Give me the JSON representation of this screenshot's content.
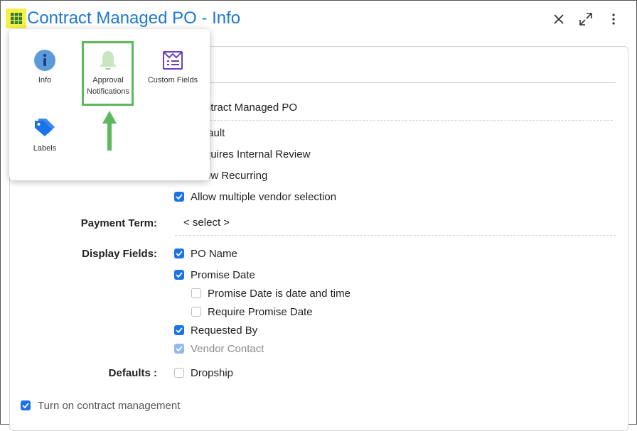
{
  "header": {
    "title": "Contract Managed PO - Info",
    "apps_icon": "grid-apps-icon",
    "close_icon": "close-icon",
    "expand_icon": "expand-icon",
    "more_icon": "more-vertical-icon"
  },
  "app_menu": {
    "items": [
      {
        "label": "Info",
        "icon": "info-icon"
      },
      {
        "label": "Approval Notifications",
        "icon": "bell-icon"
      },
      {
        "label": "Custom Fields",
        "icon": "custom-fields-icon"
      },
      {
        "label": "Labels",
        "icon": "tag-icon"
      }
    ]
  },
  "form": {
    "name_value": "ntract Managed PO",
    "flags": [
      {
        "label": "fault",
        "checked": null
      },
      {
        "label": "quires Internal Review",
        "checked": null
      },
      {
        "label": "ow Recurring",
        "checked": null
      },
      {
        "label": "Allow multiple vendor selection",
        "checked": true
      }
    ],
    "payment_term_label": "Payment Term:",
    "payment_term_value": "< select >",
    "display_fields_label": "Display Fields:",
    "display_fields": [
      {
        "label": "PO Name",
        "checked": true
      },
      {
        "label": "Promise Date",
        "checked": true
      },
      {
        "label": "Promise Date is date and time",
        "checked": false
      },
      {
        "label": "Require Promise Date",
        "checked": false
      },
      {
        "label": "Requested By",
        "checked": true
      },
      {
        "label": "Vendor Contact",
        "checked": true,
        "disabled": true
      }
    ],
    "defaults_label": "Defaults :",
    "defaults": [
      {
        "label": "Dropship",
        "checked": false
      }
    ],
    "contract_management_label": "Turn on contract management",
    "contract_management_checked": true
  },
  "colors": {
    "accent": "#1a73e8",
    "title": "#1f78d1",
    "highlight": "#5cb85c",
    "apps_button": "#f6f04a"
  }
}
